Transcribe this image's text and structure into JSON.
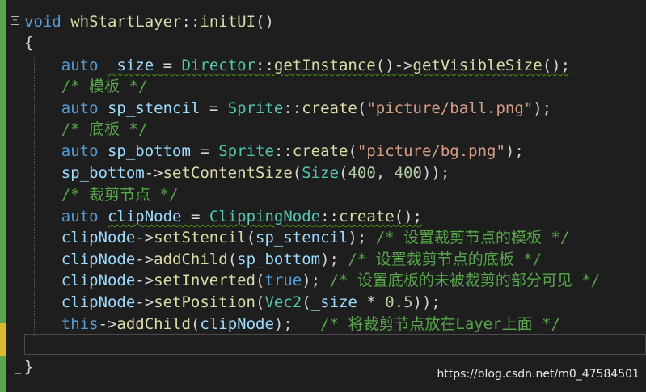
{
  "editor": {
    "language": "C++",
    "colors": {
      "background": "#1e1e1e",
      "keyword": "#569cd6",
      "function": "#dcdcaa",
      "type": "#4ec9b0",
      "string": "#d69d85",
      "number": "#b5cea8",
      "comment": "#57a64a",
      "change_bar": "#57a64a"
    },
    "fold_toggle_glyph": "−",
    "lines": [
      {
        "t": [
          [
            "kw",
            "void"
          ],
          [
            "op",
            " "
          ],
          [
            "fn",
            "whStartLayer"
          ],
          [
            "op",
            "::"
          ],
          [
            "fn",
            "initUI"
          ],
          [
            "op",
            "()"
          ]
        ]
      },
      {
        "t": [
          [
            "op",
            "{"
          ]
        ]
      },
      {
        "t": [
          [
            "op",
            "    "
          ],
          [
            "kw",
            "auto"
          ],
          [
            "op",
            " "
          ],
          [
            "vr",
            "_size"
          ],
          [
            "op",
            " = "
          ],
          [
            "ty",
            "Director"
          ],
          [
            "op",
            "::"
          ],
          [
            "fn",
            "getInstance"
          ],
          [
            "op",
            "()->"
          ],
          [
            "fn",
            "getVisibleSize"
          ],
          [
            "op",
            "();"
          ]
        ]
      },
      {
        "t": [
          [
            "op",
            "    "
          ],
          [
            "cm",
            "/* 模板 */"
          ]
        ]
      },
      {
        "t": [
          [
            "op",
            "    "
          ],
          [
            "kw",
            "auto"
          ],
          [
            "op",
            " "
          ],
          [
            "vr",
            "sp_stencil"
          ],
          [
            "op",
            " = "
          ],
          [
            "ty",
            "Sprite"
          ],
          [
            "op",
            "::"
          ],
          [
            "fn",
            "create"
          ],
          [
            "op",
            "("
          ],
          [
            "str",
            "\"picture/ball.png\""
          ],
          [
            "op",
            ");"
          ]
        ]
      },
      {
        "t": [
          [
            "op",
            "    "
          ],
          [
            "cm",
            "/* 底板 */"
          ]
        ]
      },
      {
        "t": [
          [
            "op",
            "    "
          ],
          [
            "kw",
            "auto"
          ],
          [
            "op",
            " "
          ],
          [
            "vr",
            "sp_bottom"
          ],
          [
            "op",
            " = "
          ],
          [
            "ty",
            "Sprite"
          ],
          [
            "op",
            "::"
          ],
          [
            "fn",
            "create"
          ],
          [
            "op",
            "("
          ],
          [
            "str",
            "\"picture/bg.png\""
          ],
          [
            "op",
            ");"
          ]
        ]
      },
      {
        "t": [
          [
            "op",
            "    "
          ],
          [
            "vr",
            "sp_bottom"
          ],
          [
            "op",
            "->"
          ],
          [
            "fn",
            "setContentSize"
          ],
          [
            "op",
            "("
          ],
          [
            "ty",
            "Size"
          ],
          [
            "op",
            "("
          ],
          [
            "num",
            "400"
          ],
          [
            "op",
            ", "
          ],
          [
            "num",
            "400"
          ],
          [
            "op",
            "));"
          ]
        ]
      },
      {
        "t": [
          [
            "op",
            "    "
          ],
          [
            "cm",
            "/* 裁剪节点 */"
          ]
        ]
      },
      {
        "t": [
          [
            "op",
            "    "
          ],
          [
            "kw",
            "auto"
          ],
          [
            "op",
            " "
          ],
          [
            "vr",
            "clipNode"
          ],
          [
            "op",
            " = "
          ],
          [
            "ty",
            "ClippingNode"
          ],
          [
            "op",
            "::"
          ],
          [
            "fn",
            "create"
          ],
          [
            "op",
            "();"
          ]
        ]
      },
      {
        "t": [
          [
            "op",
            "    "
          ],
          [
            "vr",
            "clipNode"
          ],
          [
            "op",
            "->"
          ],
          [
            "fn",
            "setStencil"
          ],
          [
            "op",
            "("
          ],
          [
            "vr",
            "sp_stencil"
          ],
          [
            "op",
            "); "
          ],
          [
            "cm",
            "/* 设置裁剪节点的模板 */"
          ]
        ]
      },
      {
        "t": [
          [
            "op",
            "    "
          ],
          [
            "vr",
            "clipNode"
          ],
          [
            "op",
            "->"
          ],
          [
            "fn",
            "addChild"
          ],
          [
            "op",
            "("
          ],
          [
            "vr",
            "sp_bottom"
          ],
          [
            "op",
            "); "
          ],
          [
            "cm",
            "/* 设置裁剪节点的底板 */"
          ]
        ]
      },
      {
        "t": [
          [
            "op",
            "    "
          ],
          [
            "vr",
            "clipNode"
          ],
          [
            "op",
            "->"
          ],
          [
            "fn",
            "setInverted"
          ],
          [
            "op",
            "("
          ],
          [
            "kw",
            "true"
          ],
          [
            "op",
            "); "
          ],
          [
            "cm",
            "/* 设置底板的未被裁剪的部分可见 */"
          ]
        ]
      },
      {
        "t": [
          [
            "op",
            "    "
          ],
          [
            "vr",
            "clipNode"
          ],
          [
            "op",
            "->"
          ],
          [
            "fn",
            "setPosition"
          ],
          [
            "op",
            "("
          ],
          [
            "ty",
            "Vec2"
          ],
          [
            "op",
            "("
          ],
          [
            "vr",
            "_size"
          ],
          [
            "op",
            " * "
          ],
          [
            "num",
            "0.5"
          ],
          [
            "op",
            "));"
          ]
        ]
      },
      {
        "t": [
          [
            "op",
            "    "
          ],
          [
            "kw",
            "this"
          ],
          [
            "op",
            "->"
          ],
          [
            "fn",
            "addChild"
          ],
          [
            "op",
            "("
          ],
          [
            "vr",
            "clipNode"
          ],
          [
            "op",
            ");   "
          ],
          [
            "cm",
            "/* 将裁剪节点放在Layer上面 */"
          ]
        ]
      },
      {
        "t": []
      },
      {
        "t": [
          [
            "op",
            "}"
          ]
        ]
      }
    ]
  },
  "watermark": "https://blog.csdn.net/m0_47584501"
}
